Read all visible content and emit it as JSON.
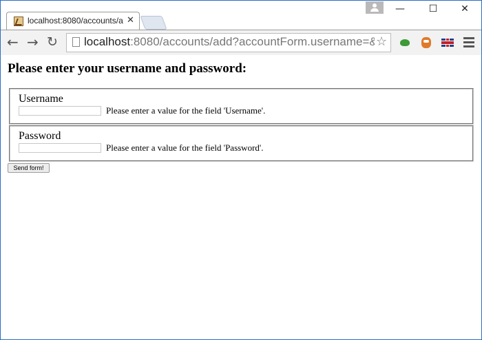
{
  "browser": {
    "tab_title": "localhost:8080/accounts/a",
    "tab_close": "✕",
    "url_host": "localhost",
    "url_rest": ":8080/accounts/add?accountForm.username=&acco",
    "window_controls": {
      "minimize": "—",
      "maximize": "☐",
      "close": "✕"
    },
    "nav": {
      "back": "←",
      "forward": "→",
      "reload": "↻"
    },
    "bookmark_star": "☆",
    "extensions": [
      "frog-extension-icon",
      "owl-extension-icon",
      "uk-flag-icon"
    ]
  },
  "page": {
    "heading": "Please enter your username and password:",
    "fields": [
      {
        "label": "Username",
        "value": "",
        "message": "Please enter a value for the field 'Username'."
      },
      {
        "label": "Password",
        "value": "",
        "message": "Please enter a value for the field 'Password'."
      }
    ],
    "submit_label": "Send form!"
  }
}
